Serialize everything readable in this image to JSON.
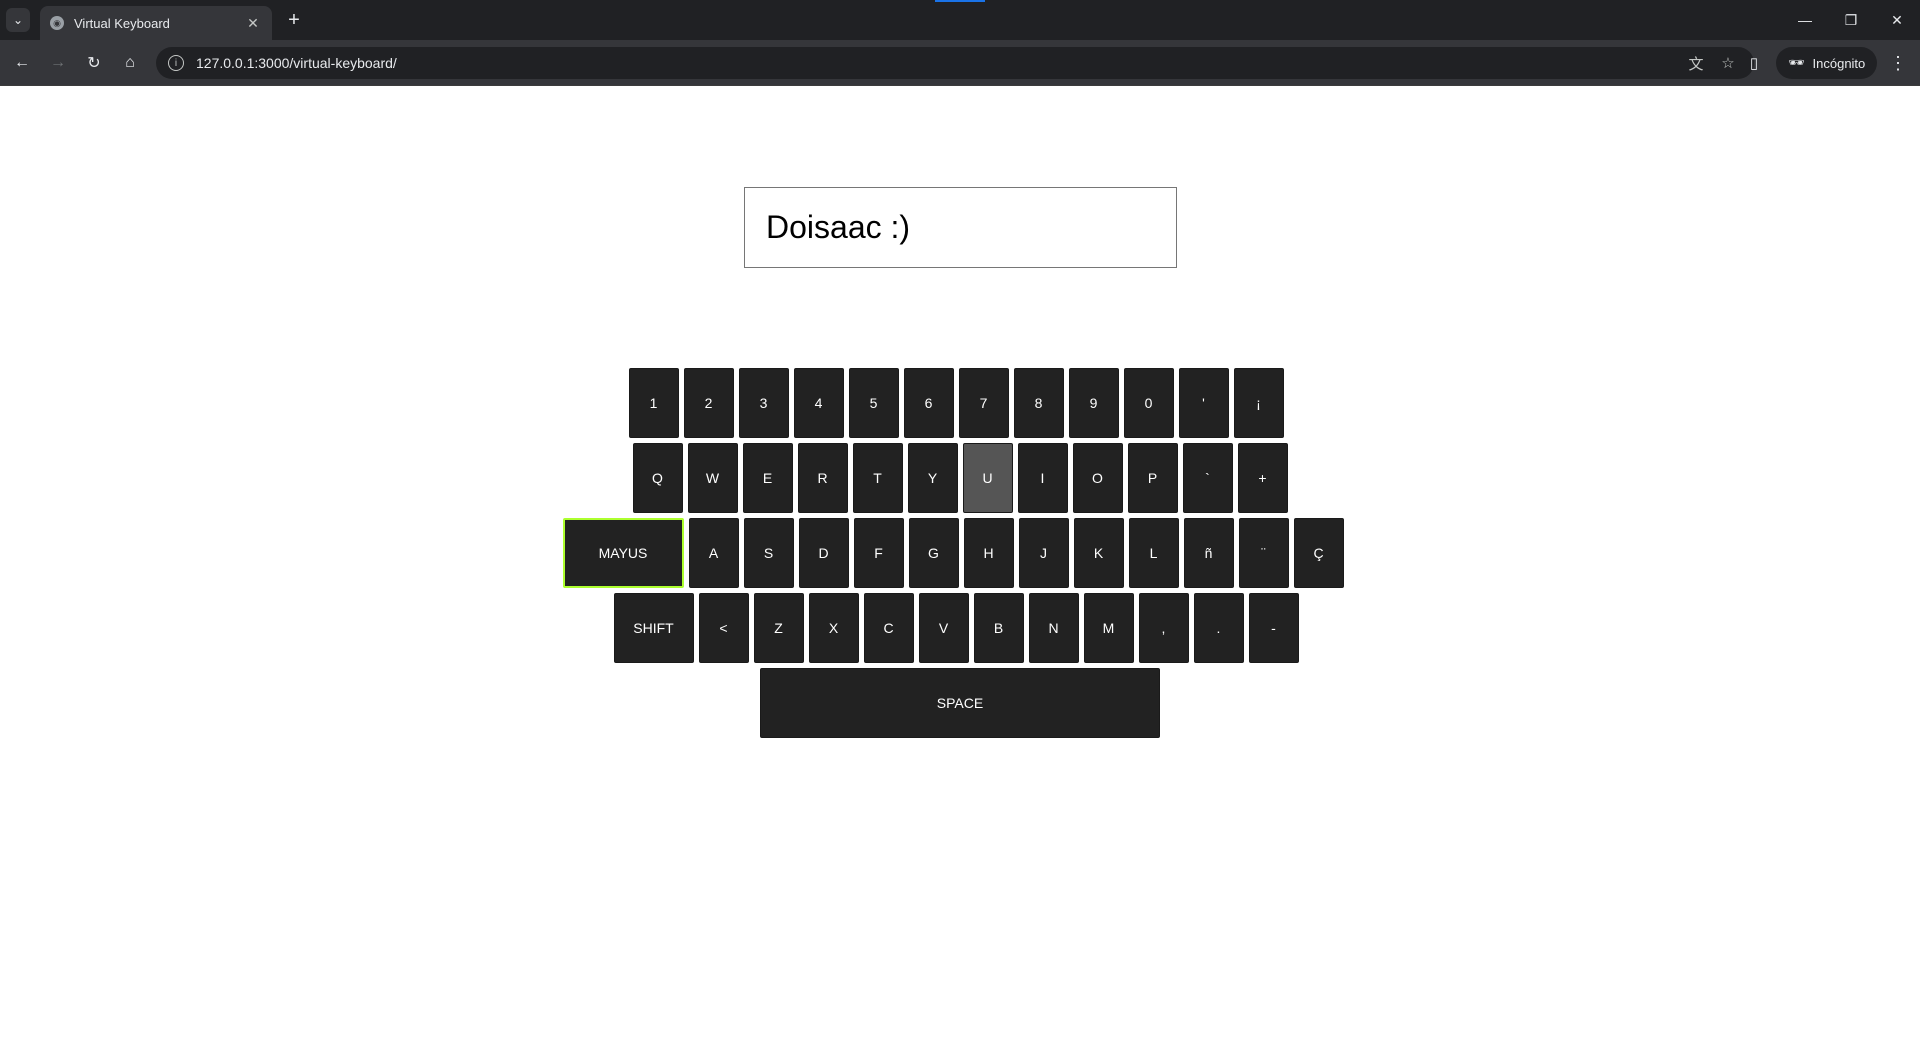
{
  "browser": {
    "tab_title": "Virtual Keyboard",
    "url": "127.0.0.1:3000/virtual-keyboard/",
    "incognito_label": "Incógnito"
  },
  "input": {
    "value": "Doisaac :)"
  },
  "keyboard": {
    "row1": [
      "1",
      "2",
      "3",
      "4",
      "5",
      "6",
      "7",
      "8",
      "9",
      "0",
      "'",
      "¡"
    ],
    "row2": [
      "Q",
      "W",
      "E",
      "R",
      "T",
      "Y",
      "U",
      "I",
      "O",
      "P",
      "`",
      "+"
    ],
    "row3": [
      "MAYUS",
      "A",
      "S",
      "D",
      "F",
      "G",
      "H",
      "J",
      "K",
      "L",
      "ñ",
      "¨",
      "Ç"
    ],
    "row4": [
      "SHIFT",
      "<",
      "Z",
      "X",
      "C",
      "V",
      "B",
      "N",
      "M",
      ",",
      ".",
      "-"
    ],
    "row5": [
      "SPACE"
    ],
    "highlighted_key": "U",
    "focused_key": "MAYUS",
    "focus_color": "#adff2f",
    "key_color": "#222222",
    "active_key_color": "#555555"
  }
}
